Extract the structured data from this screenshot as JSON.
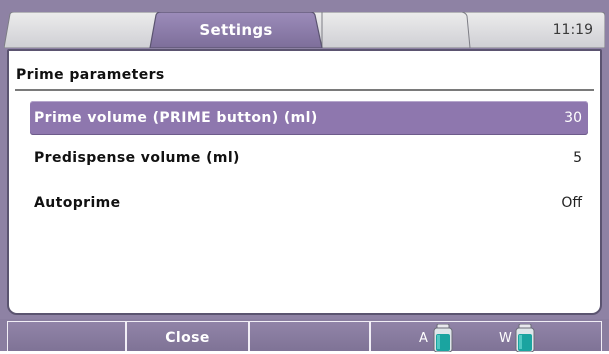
{
  "header": {
    "active_tab": "Settings",
    "time": "11:19"
  },
  "section": {
    "title": "Prime parameters"
  },
  "rows": [
    {
      "label": "Prime volume (PRIME button) (ml)",
      "value": "30",
      "selected": true
    },
    {
      "label": "Predispense volume (ml)",
      "value": "5",
      "selected": false
    },
    {
      "label": "Autoprime",
      "value": "Off",
      "selected": false
    }
  ],
  "footer": {
    "close_label": "Close",
    "bottle_a_label": "A",
    "bottle_w_label": "W"
  },
  "colors": {
    "selected_row": "#8e77ae",
    "chrome": "#8e82a4",
    "bottle_liquid": "#1aa4a0"
  }
}
